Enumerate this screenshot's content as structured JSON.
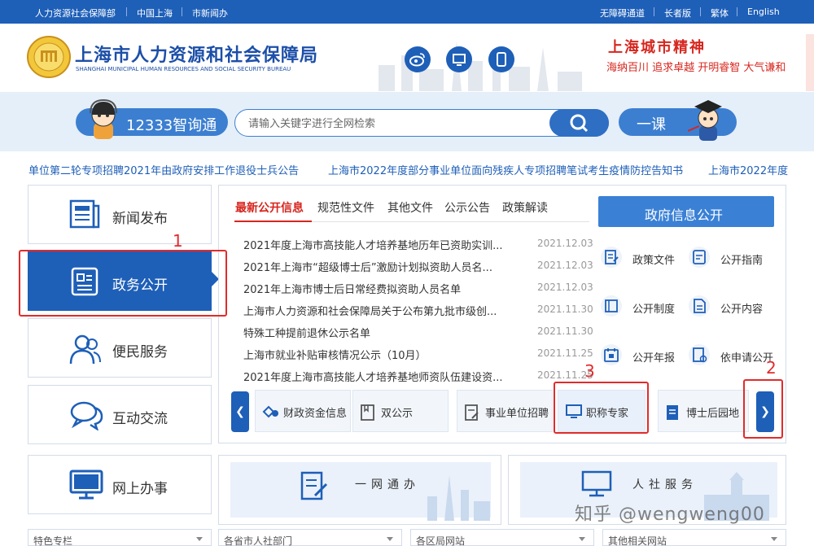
{
  "topbar": {
    "left_links": [
      "人力资源社会保障部",
      "中国上海",
      "市新闻办"
    ],
    "right_links": [
      "无障碍通道",
      "长者版",
      "繁体",
      "English"
    ]
  },
  "header": {
    "title": "上海市人力资源和社会保障局",
    "subtitle": "SHANGHAI MUNICIPAL HUMAN RESOURCES AND SOCIAL SECURITY BUREAU",
    "slogan_title": "上海城市精神",
    "slogan_sub": "海纳百川  追求卓越  开明睿智  大气谦和"
  },
  "search": {
    "smart_label": "12333智询通",
    "placeholder": "请输入关键字进行全网检索",
    "course_label": "一课"
  },
  "marquee": [
    "单位第二轮专项招聘2021年由政府安排工作退役士兵公告",
    "上海市2022年度部分事业单位面向残疾人专项招聘笔试考生疫情防控告知书",
    "上海市2022年度"
  ],
  "nav": {
    "items": [
      {
        "label": "新闻发布",
        "icon": "news-icon"
      },
      {
        "label": "政务公开",
        "icon": "document-icon"
      },
      {
        "label": "便民服务",
        "icon": "people-icon"
      },
      {
        "label": "互动交流",
        "icon": "chat-icon"
      },
      {
        "label": "网上办事",
        "icon": "monitor-icon"
      }
    ]
  },
  "tabs": [
    "最新公开信息",
    "规范性文件",
    "其他文件",
    "公示公告",
    "政策解读"
  ],
  "news": [
    {
      "title": "2021年度上海市高技能人才培养基地历年已资助实训...",
      "date": "2021.12.03"
    },
    {
      "title": "2021年上海市“超级博士后”激励计划拟资助人员名...",
      "date": "2021.12.03"
    },
    {
      "title": "2021年上海市博士后日常经费拟资助人员名单",
      "date": "2021.12.03"
    },
    {
      "title": "上海市人力资源和社会保障局关于公布第九批市级创...",
      "date": "2021.11.30"
    },
    {
      "title": "特殊工种提前退休公示名单",
      "date": "2021.11.30"
    },
    {
      "title": "上海市就业补贴审核情况公示（10月）",
      "date": "2021.11.25"
    },
    {
      "title": "2021年度上海市高技能人才培养基地师资队伍建设资...",
      "date": "2021.11.25"
    }
  ],
  "gov_info": {
    "title": "政府信息公开",
    "items": [
      "政策文件",
      "公开指南",
      "公开制度",
      "公开内容",
      "公开年报",
      "依申请公开"
    ]
  },
  "quick_links": [
    "财政资金信息",
    "双公示",
    "事业单位招聘",
    "职称专家",
    "博士后园地"
  ],
  "annotations": [
    "1",
    "2",
    "3"
  ],
  "banners": [
    "一网通办",
    "人社服务"
  ],
  "bottom_selects": [
    "特色专栏",
    "各省市人社部门",
    "各区局网站",
    "其他相关网站"
  ],
  "watermark": "知乎 @wengweng00",
  "colors": {
    "primary": "#1e5fb8",
    "accent_red": "#d7261e",
    "annotation_red": "#e12b2b"
  }
}
